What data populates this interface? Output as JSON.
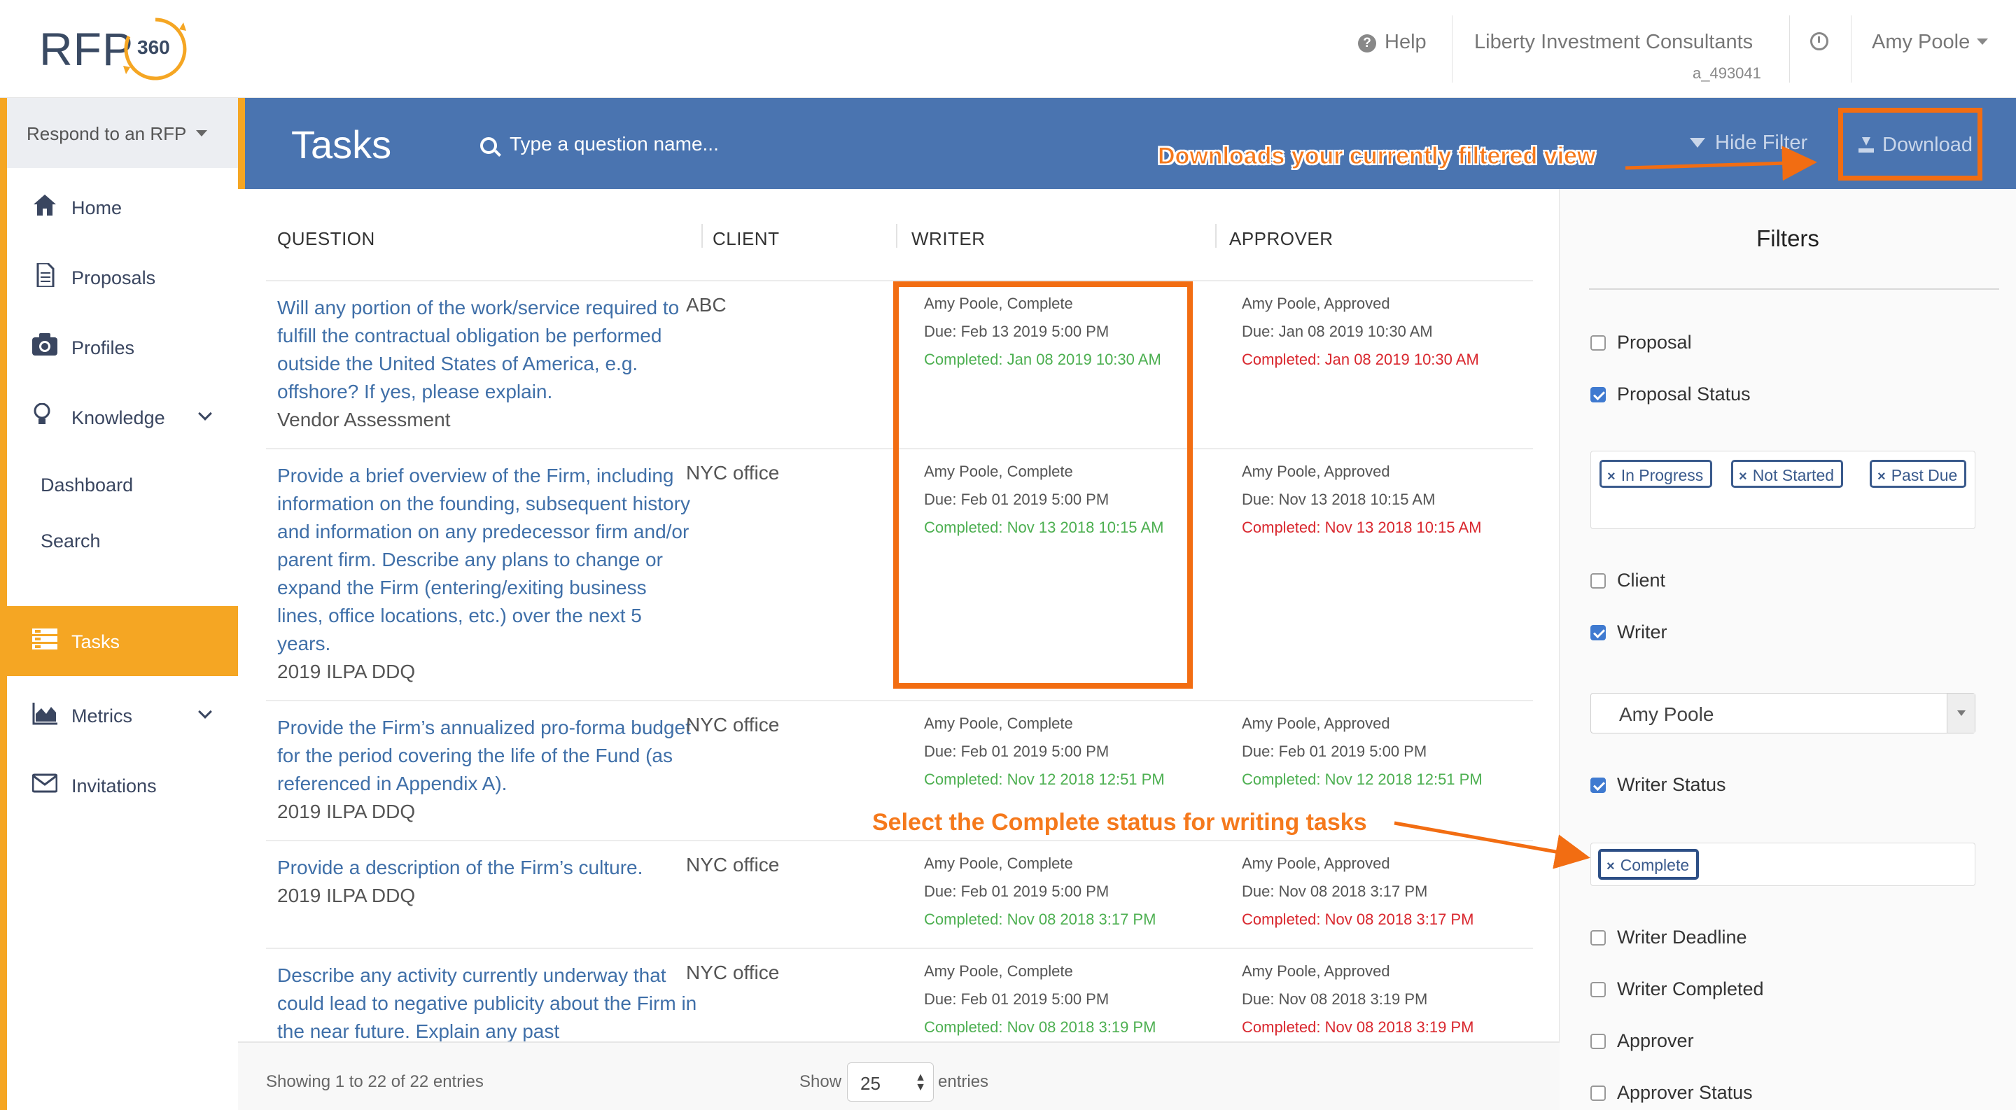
{
  "header": {
    "logo_text": "RFP",
    "logo_badge": "360",
    "help_label": "Help",
    "company": "Liberty Investment Consultants",
    "account_id": "a_493041",
    "user": "Amy Poole"
  },
  "sidebar": {
    "respond_label": "Respond to an RFP",
    "items": [
      {
        "label": "Home",
        "icon": "home-icon"
      },
      {
        "label": "Proposals",
        "icon": "document-icon"
      },
      {
        "label": "Profiles",
        "icon": "camera-icon"
      },
      {
        "label": "Knowledge",
        "icon": "lightbulb-icon"
      },
      {
        "label": "Dashboard"
      },
      {
        "label": "Search"
      },
      {
        "label": "Tasks",
        "icon": "tasks-icon",
        "active": true
      },
      {
        "label": "Metrics",
        "icon": "area-chart-icon"
      },
      {
        "label": "Invitations",
        "icon": "envelope-icon"
      }
    ]
  },
  "toolbar": {
    "title": "Tasks",
    "search_placeholder": "Type a question name...",
    "hide_filter": "Hide Filter",
    "download": "Download"
  },
  "annotations": {
    "download_callout": "Downloads your currently filtered view",
    "writer_status_callout": "Select the Complete status for writing tasks"
  },
  "table": {
    "headers": [
      "QUESTION",
      "CLIENT",
      "WRITER",
      "APPROVER"
    ],
    "rows": [
      {
        "question": "Will any portion of the work/service required to fulfill the contractual obligation be performed outside the United States of America, e.g. offshore? If yes, please explain.",
        "project": "Vendor Assessment",
        "client": "ABC",
        "writer": [
          "Amy Poole, Complete",
          "Due: Feb 13 2019 5:00 PM",
          "Completed: Jan 08 2019 10:30 AM"
        ],
        "approver": [
          "Amy Poole, Approved",
          "Due: Jan 08 2019 10:30 AM",
          "Completed: Jan 08 2019 10:30 AM"
        ]
      },
      {
        "question": "Provide a brief overview of the Firm, including information on the founding, subsequent history and information on any predecessor firm and/or parent firm. Describe any plans to change or expand the Firm (entering/exiting business lines, office locations, etc.) over the next 5 years.",
        "project": "2019 ILPA DDQ",
        "client": "NYC office",
        "writer": [
          "Amy Poole, Complete",
          "Due: Feb 01 2019 5:00 PM",
          "Completed: Nov 13 2018 10:15 AM"
        ],
        "approver": [
          "Amy Poole, Approved",
          "Due: Nov 13 2018 10:15 AM",
          "Completed: Nov 13 2018 10:15 AM"
        ]
      },
      {
        "question": "Provide the Firm’s annualized pro-forma budget for the period covering the life of the Fund (as referenced in Appendix A).",
        "project": "2019 ILPA DDQ",
        "client": "NYC office",
        "writer": [
          "Amy Poole, Complete",
          "Due: Feb 01 2019 5:00 PM",
          "Completed: Nov 12 2018 12:51 PM"
        ],
        "approver": [
          "Amy Poole, Approved",
          "Due: Feb 01 2019 5:00 PM",
          "Completed: Nov 12 2018 12:51 PM"
        ]
      },
      {
        "question": "Provide a description of the Firm’s culture.",
        "project": "2019 ILPA DDQ",
        "client": "NYC office",
        "writer": [
          "Amy Poole, Complete",
          "Due: Feb 01 2019 5:00 PM",
          "Completed: Nov 08 2018 3:17 PM"
        ],
        "approver": [
          "Amy Poole, Approved",
          "Due: Nov 08 2018 3:17 PM",
          "Completed: Nov 08 2018 3:17 PM"
        ]
      },
      {
        "question": "Describe any activity currently underway that could lead to negative publicity about the Firm in the near future. Explain any past",
        "project": "",
        "client": "NYC office",
        "writer": [
          "Amy Poole, Complete",
          "Due: Feb 01 2019 5:00 PM",
          "Completed: Nov 08 2018 3:19 PM"
        ],
        "approver": [
          "Amy Poole, Approved",
          "Due: Nov 08 2018 3:19 PM",
          "Completed: Nov 08 2018 3:19 PM"
        ]
      }
    ],
    "showing": "Showing 1 to 22 of 22 entries",
    "show_label": "Show",
    "page_size": "25",
    "entries_label": "entries"
  },
  "filters": {
    "title": "Filters",
    "options": [
      {
        "label": "Proposal",
        "checked": false
      },
      {
        "label": "Proposal Status",
        "checked": true
      },
      {
        "label": "Client",
        "checked": false
      },
      {
        "label": "Writer",
        "checked": true
      },
      {
        "label": "Writer Status",
        "checked": true
      },
      {
        "label": "Writer Deadline",
        "checked": false
      },
      {
        "label": "Writer Completed",
        "checked": false
      },
      {
        "label": "Approver",
        "checked": false
      },
      {
        "label": "Approver Status",
        "checked": false
      }
    ],
    "proposal_status_tags": [
      "In Progress",
      "Not Started",
      "Past Due"
    ],
    "writer_value": "Amy Poole",
    "writer_status_tags": [
      "Complete"
    ]
  },
  "colors": {
    "accent": "#f5a623",
    "bluebar": "#4a74b0",
    "callout": "#f26d12",
    "link": "#3f6fa8",
    "completed_green": "#4caf50",
    "completed_red": "#d9272e"
  }
}
